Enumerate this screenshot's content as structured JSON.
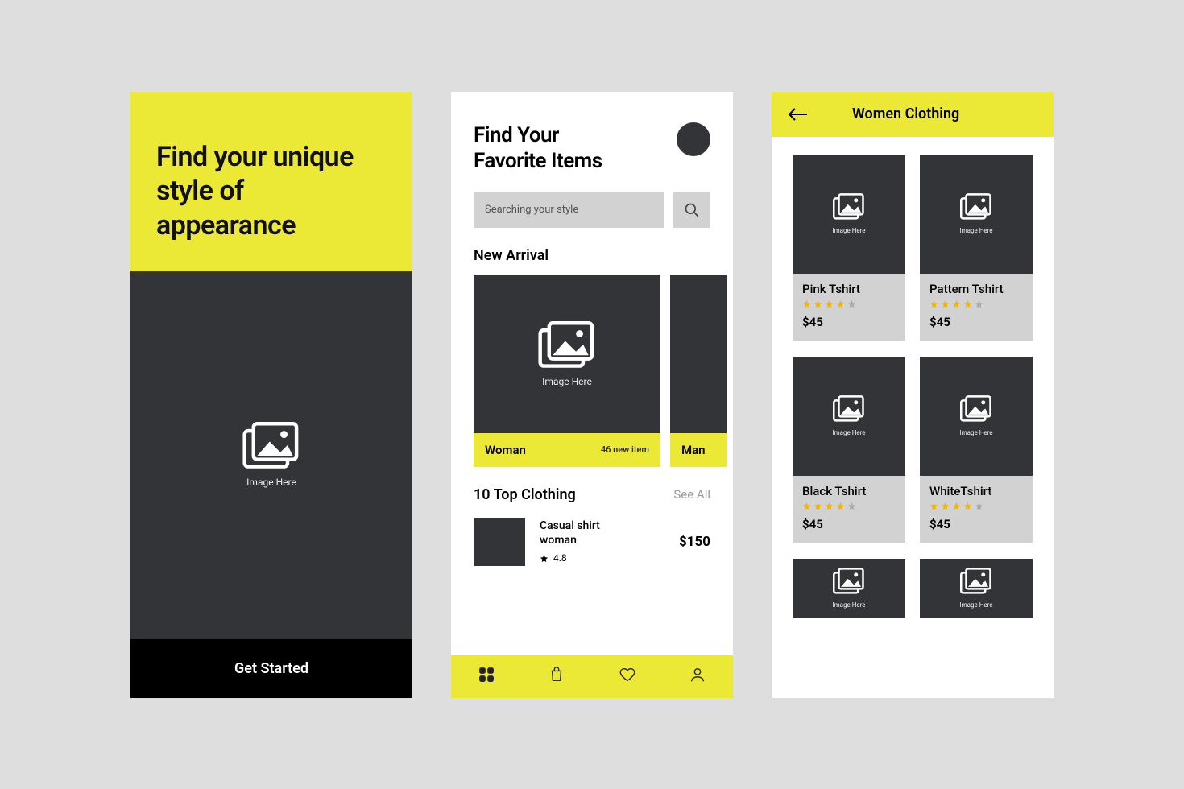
{
  "colors": {
    "accent": "#ece836",
    "dark": "#333438"
  },
  "screen1": {
    "headline": "Find your unique style of appearance",
    "image_label": "Image Here",
    "cta": "Get Started"
  },
  "screen2": {
    "title_l1": "Find Your",
    "title_l2": "Favorite Items",
    "search_placeholder": "Searching your style",
    "new_arrival_label": "New Arrival",
    "arrivals": [
      {
        "category": "Woman",
        "count": "46 new item",
        "image_label": "Image Here"
      },
      {
        "category": "Man",
        "count": "",
        "image_label": ""
      }
    ],
    "top_section_label": "10 Top Clothing",
    "see_all": "See All",
    "top_item": {
      "name": "Casual shirt woman",
      "rating": "4.8",
      "price": "$150"
    },
    "nav_icons": [
      "grid-icon",
      "bag-icon",
      "heart-icon",
      "user-icon"
    ]
  },
  "screen3": {
    "title": "Women Clothing",
    "products": [
      {
        "name": "Pink Tshirt",
        "rating": 4,
        "price": "$45",
        "image_label": "Image Here"
      },
      {
        "name": "Pattern Tshirt",
        "rating": 4,
        "price": "$45",
        "image_label": "Image Here"
      },
      {
        "name": "Black Tshirt",
        "rating": 4,
        "price": "$45",
        "image_label": "Image Here"
      },
      {
        "name": "WhiteTshirt",
        "rating": 4,
        "price": "$45",
        "image_label": "Image Here"
      }
    ]
  }
}
